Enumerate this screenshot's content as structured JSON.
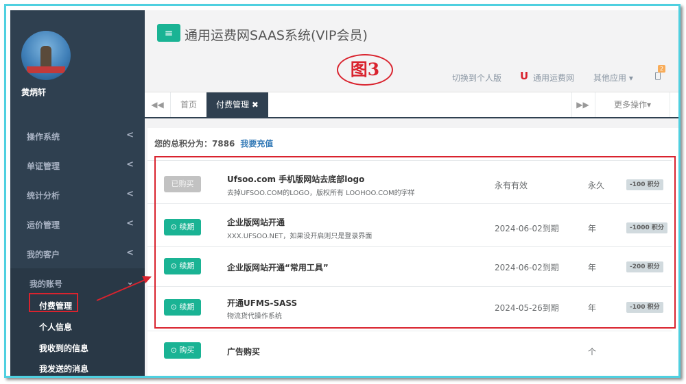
{
  "user": {
    "name": "黄炳轩"
  },
  "sidebar": {
    "items": [
      {
        "label": "操作系统",
        "chevron": "<"
      },
      {
        "label": "单证管理",
        "chevron": "<"
      },
      {
        "label": "统计分析",
        "chevron": "<"
      },
      {
        "label": "运价管理",
        "chevron": "<"
      },
      {
        "label": "我的客户",
        "chevron": "<"
      },
      {
        "label": "我的账号",
        "chevron": "⌄"
      }
    ],
    "subitems": [
      {
        "label": "付费管理"
      },
      {
        "label": "个人信息"
      },
      {
        "label": "我收到的信息"
      },
      {
        "label": "我发送的消息"
      }
    ]
  },
  "header": {
    "menu_icon": "≡",
    "title": "通用运费网SAAS系统(VIP会员)",
    "figure_label": "图3",
    "switch_link": "切换到个人版",
    "brand_link": "通用运费网",
    "brand_logo": "U",
    "other_apps": "其他应用 ▾",
    "badge_count": "2"
  },
  "tabs": {
    "nav_left": "◀◀",
    "home": "首页",
    "active": "付费管理 ✖",
    "nav_right": "▶▶",
    "more": "更多操作▾"
  },
  "content": {
    "score_label": "您的总积分为：7886",
    "recharge_link": "我要充值",
    "rows": [
      {
        "button": "已购买",
        "button_state": "disabled",
        "title": "Ufsoo.com 手机版网站去底部logo",
        "desc": "去掉UFSOO.COM的LOGO，版权所有 LOOHOO.COM的字样",
        "expiry": "永有有效",
        "unit": "永久",
        "points": "-100 积分"
      },
      {
        "button": "⊙ 续期",
        "button_state": "active",
        "title": "企业版网站开通",
        "desc": "XXX.UFSOO.NET，如果没开启则只是登录界面",
        "expiry": "2024-06-02到期",
        "unit": "年",
        "points": "-1000 积分"
      },
      {
        "button": "⊙ 续期",
        "button_state": "active",
        "title": "企业版网站开通“常用工具”",
        "desc": "",
        "expiry": "2024-06-02到期",
        "unit": "年",
        "points": "-200 积分"
      },
      {
        "button": "⊙ 续期",
        "button_state": "active",
        "title": "开通UFMS-SASS",
        "desc": "物流货代操作系统",
        "expiry": "2024-05-26到期",
        "unit": "年",
        "points": "-100 积分"
      },
      {
        "button": "⊙ 购买",
        "button_state": "active",
        "title": "广告购买",
        "desc": "",
        "expiry": "",
        "unit": "个",
        "points": ""
      }
    ]
  },
  "colors": {
    "accent": "#1ab394",
    "sidebar": "#2f4050",
    "highlight": "#d9232e",
    "frame": "#4fd0e0"
  }
}
